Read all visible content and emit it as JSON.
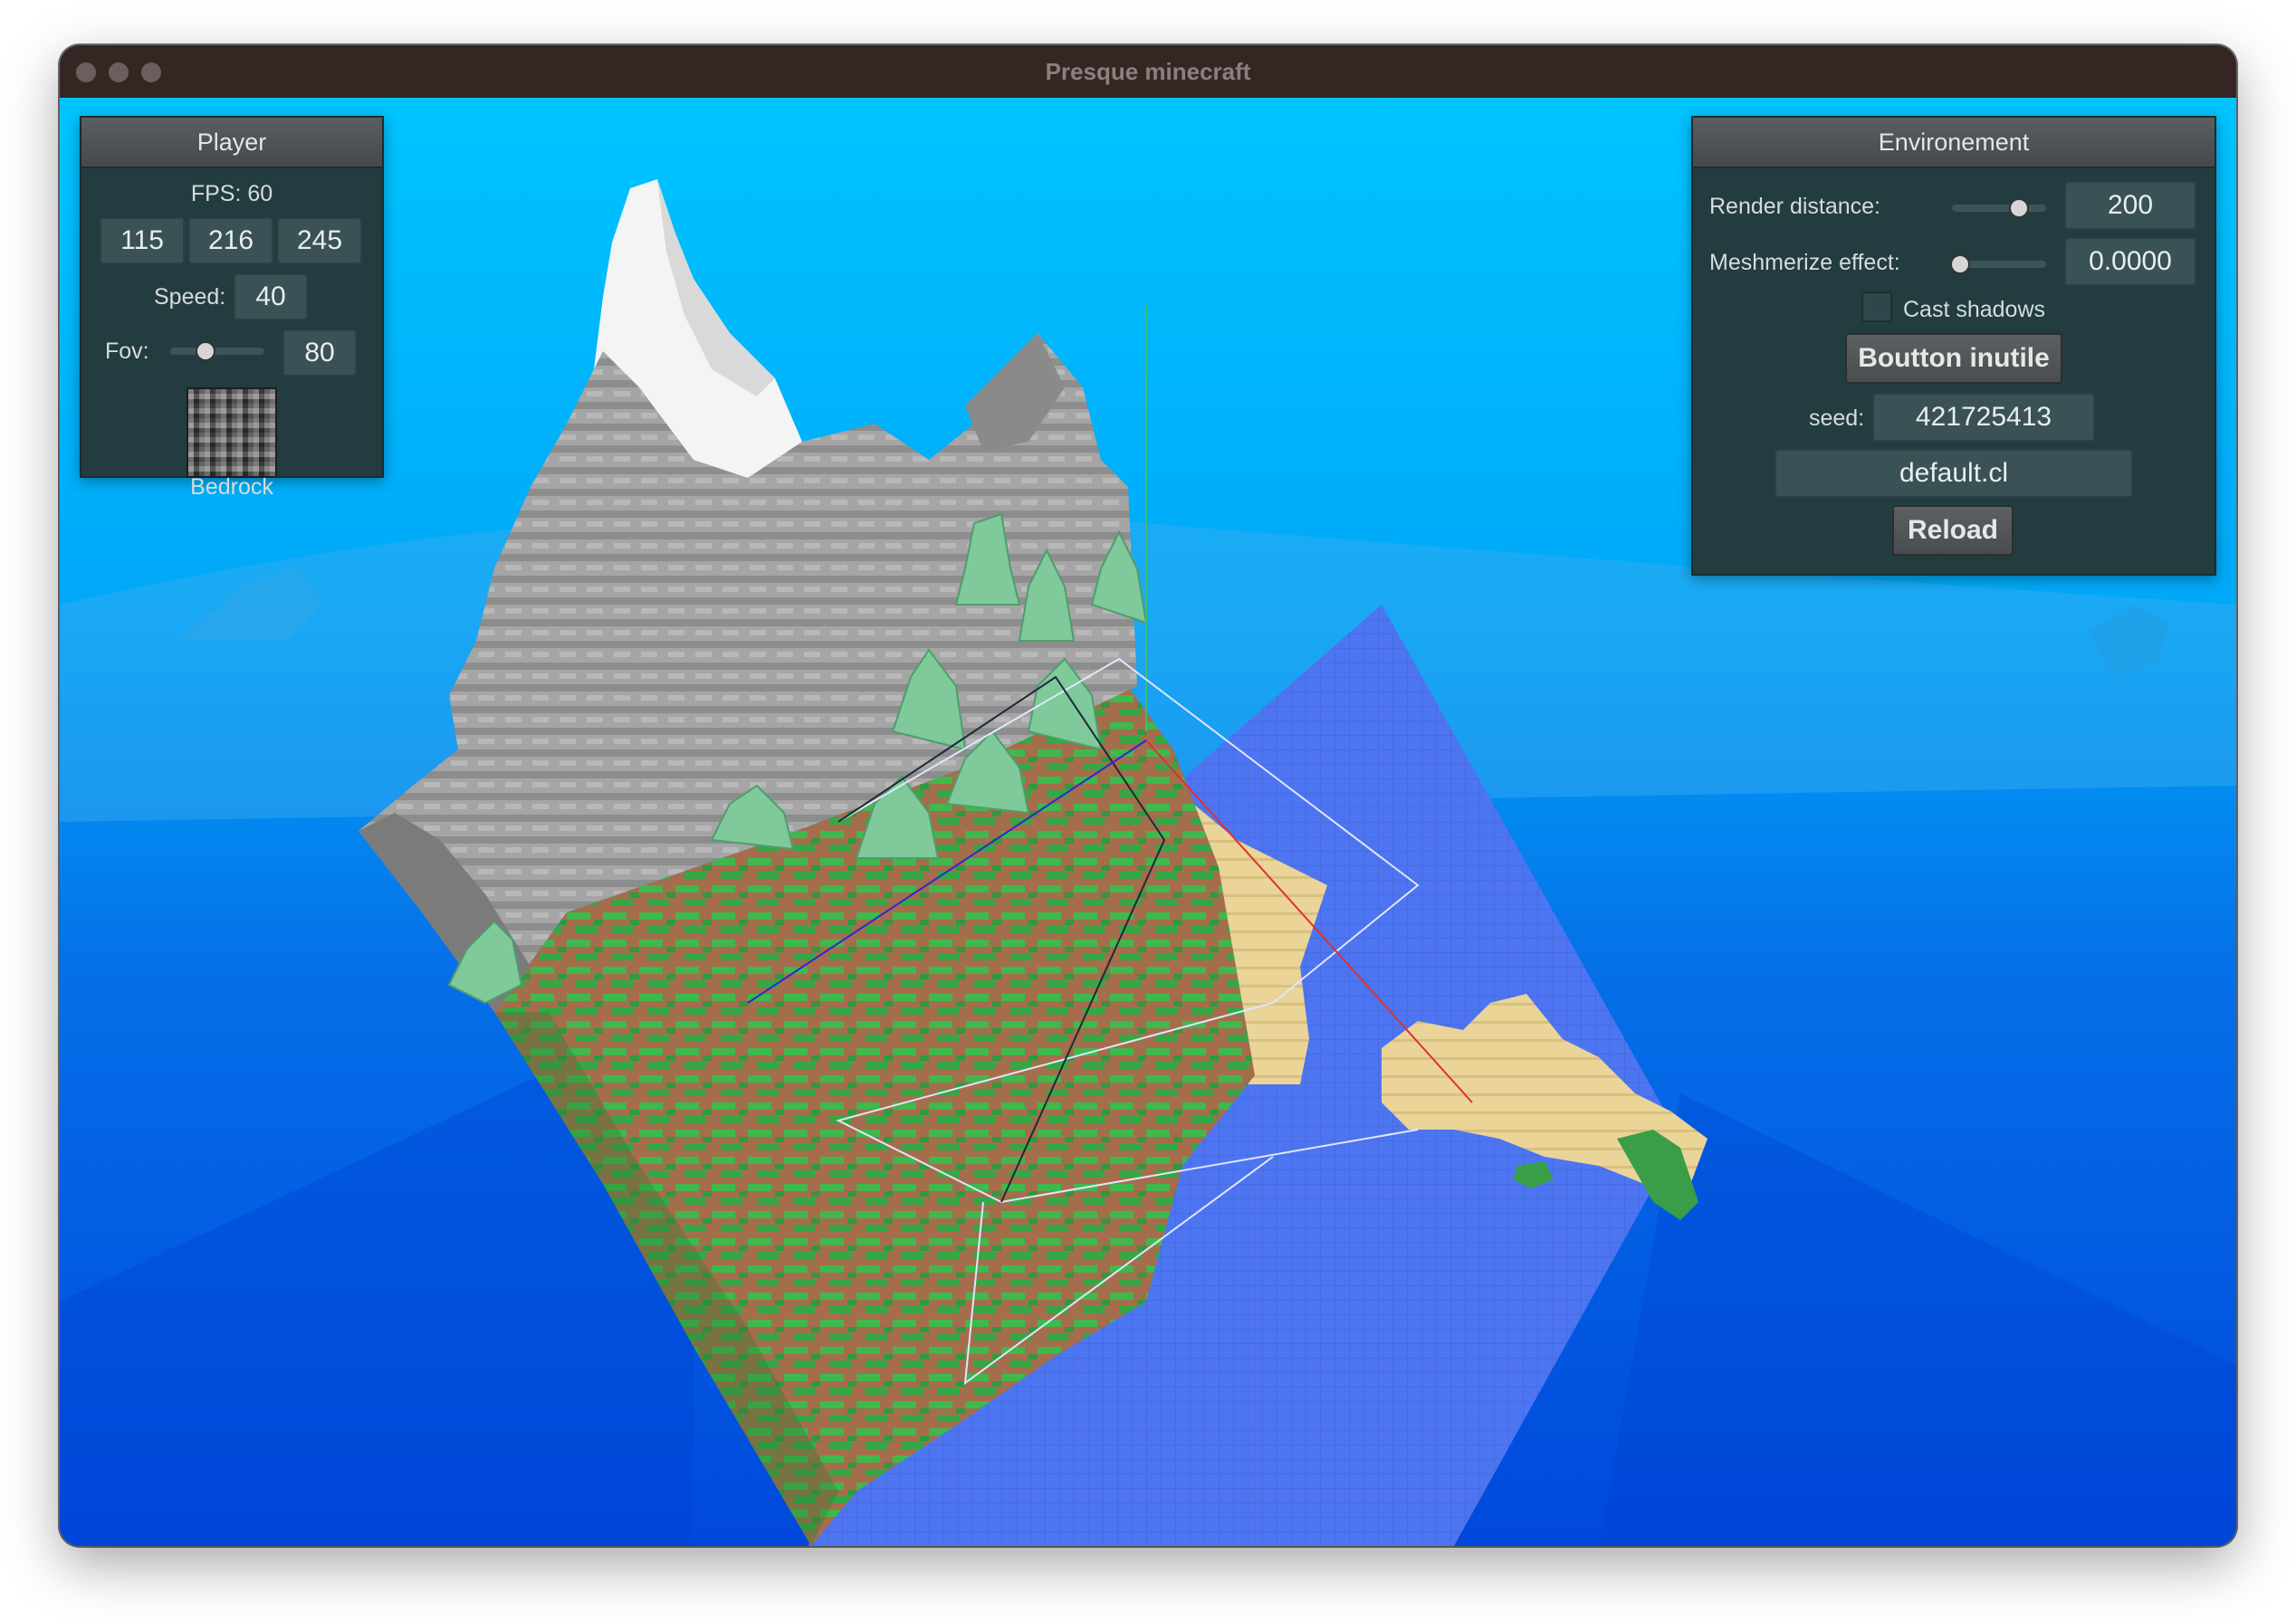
{
  "window": {
    "title": "Presque minecraft"
  },
  "player_panel": {
    "title": "Player",
    "fps_label": "FPS: 60",
    "position": [
      "115",
      "216",
      "245"
    ],
    "speed_label": "Speed:",
    "speed_value": "40",
    "fov_label": "Fov:",
    "fov_value": "80",
    "fov_slider_fraction": 0.35,
    "block_name": "Bedrock"
  },
  "environment_panel": {
    "title": "Environement",
    "render_distance_label": "Render distance:",
    "render_distance_value": "200",
    "render_distance_slider_fraction": 0.75,
    "meshmerize_label": "Meshmerize effect:",
    "meshmerize_value": "0.0000",
    "meshmerize_slider_fraction": 0.0,
    "cast_shadows_label": "Cast shadows",
    "cast_shadows_checked": false,
    "useless_button_label": "Boutton inutile",
    "seed_label": "seed:",
    "seed_value": "421725413",
    "file_value": "default.cl",
    "reload_label": "Reload"
  },
  "colors": {
    "titlebar": "#352624",
    "sky_top": "#00c0ff",
    "sky_bottom": "#0050e0",
    "water": "#4f77f0",
    "snow": "#f2f2f2",
    "stone": "#9d9d9d",
    "dirt": "#a7714f",
    "grass": "#3db94b",
    "sand": "#e9d496",
    "tree": "#7fc89a",
    "panel_bg": "#233c40"
  }
}
